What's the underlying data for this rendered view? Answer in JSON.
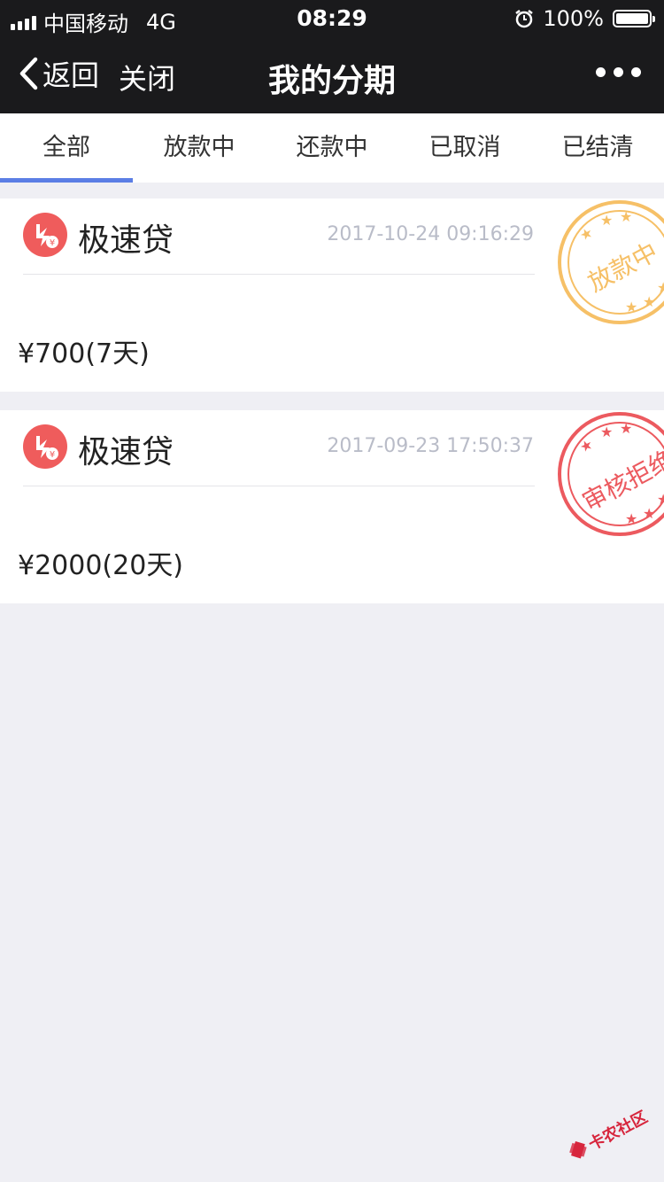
{
  "status_bar": {
    "carrier": "中国移动",
    "network": "4G",
    "time": "08:29",
    "battery": "100%"
  },
  "nav": {
    "back_label": "返回",
    "close_label": "关闭",
    "title": "我的分期"
  },
  "tabs": [
    {
      "label": "全部",
      "active": true
    },
    {
      "label": "放款中",
      "active": false
    },
    {
      "label": "还款中",
      "active": false
    },
    {
      "label": "已取消",
      "active": false
    },
    {
      "label": "已结清",
      "active": false
    }
  ],
  "loans": [
    {
      "name": "极速贷",
      "date": "2017-10-24 09:16:29",
      "amount": "¥700(7天)",
      "stamp": {
        "text": "放款中",
        "color": "#f6c067"
      }
    },
    {
      "name": "极速贷",
      "date": "2017-09-23 17:50:37",
      "amount": "¥2000(20天)",
      "stamp": {
        "text": "审核拒绝",
        "color": "#ec5a5f"
      }
    }
  ],
  "watermark": "卡农社区",
  "colors": {
    "accent": "#5b7ee5",
    "logo": "#ef5c5c",
    "header_bg": "#1a1a1c",
    "page_bg": "#efeff4"
  }
}
